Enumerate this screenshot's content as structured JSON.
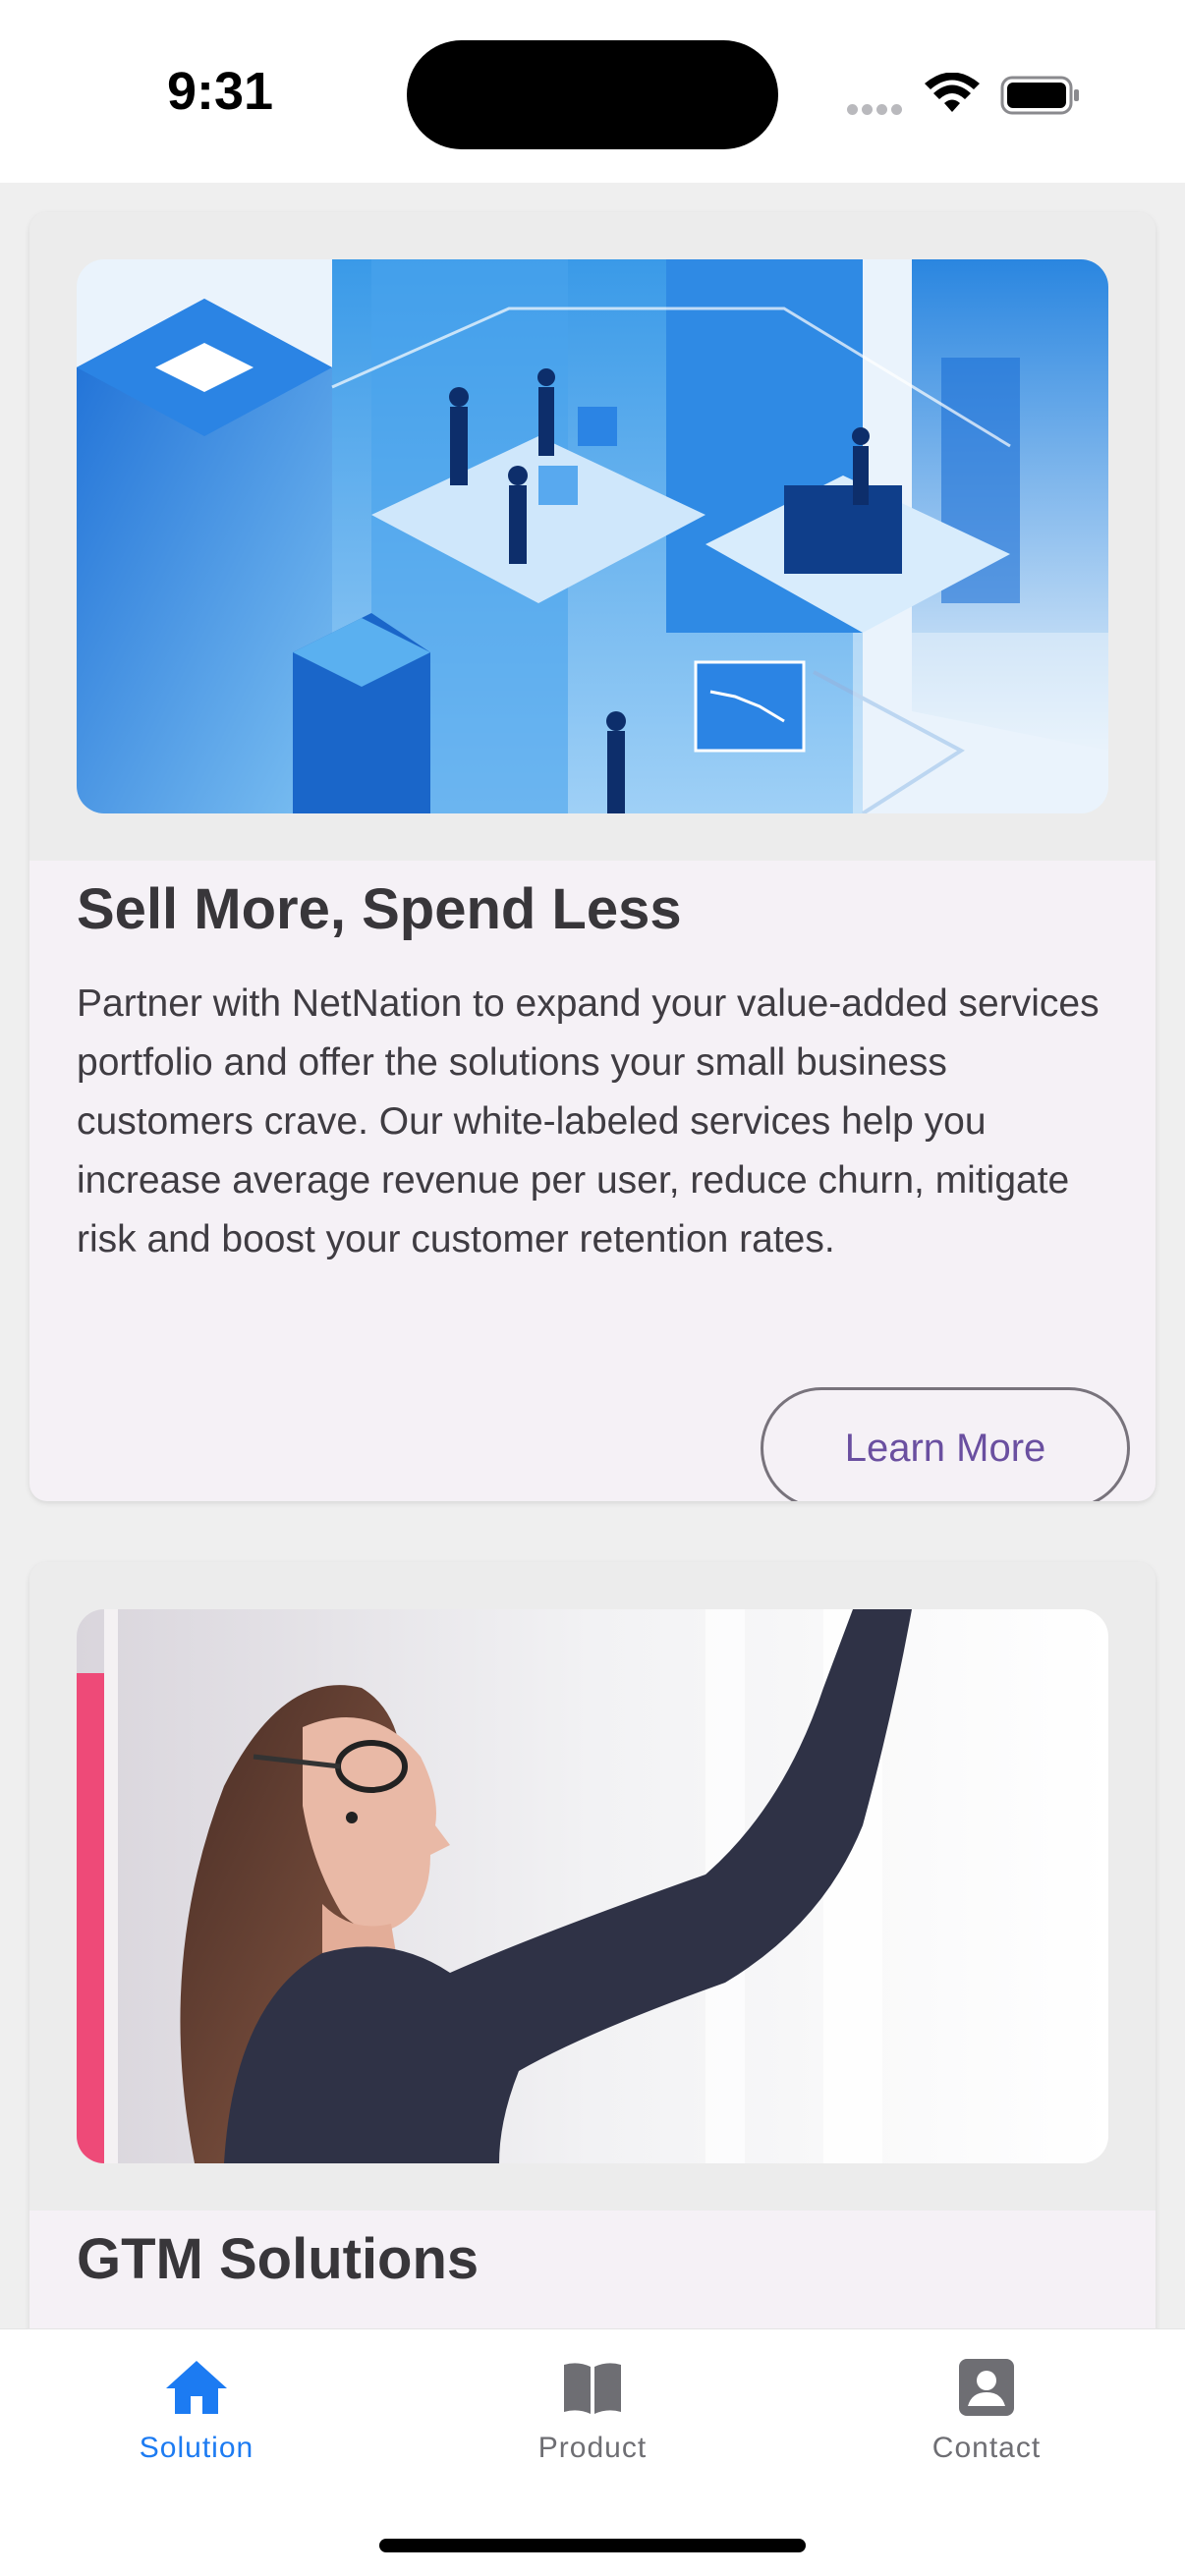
{
  "status_bar": {
    "time": "9:31"
  },
  "cards": [
    {
      "title": "Sell More, Spend Less",
      "description": "Partner with NetNation to expand your value-added services portfolio and offer the solutions your small business customers crave. Our white-labeled services help you increase average revenue per user, reduce churn, mitigate risk and boost your customer retention rates.",
      "button_label": "Learn More",
      "image_icon": "isometric-office-illustration"
    },
    {
      "title": "GTM Solutions",
      "image_icon": "woman-writing-on-board-photo"
    }
  ],
  "bottom_nav": {
    "items": [
      {
        "label": "Solution",
        "icon": "home-icon",
        "active": true
      },
      {
        "label": "Product",
        "icon": "book-icon",
        "active": false
      },
      {
        "label": "Contact",
        "icon": "contact-card-icon",
        "active": false
      }
    ]
  },
  "colors": {
    "accent": "#1c7bf2",
    "button_text": "#6a4fa0",
    "card_bg": "#f5f1f6",
    "page_bg": "#efefef"
  }
}
